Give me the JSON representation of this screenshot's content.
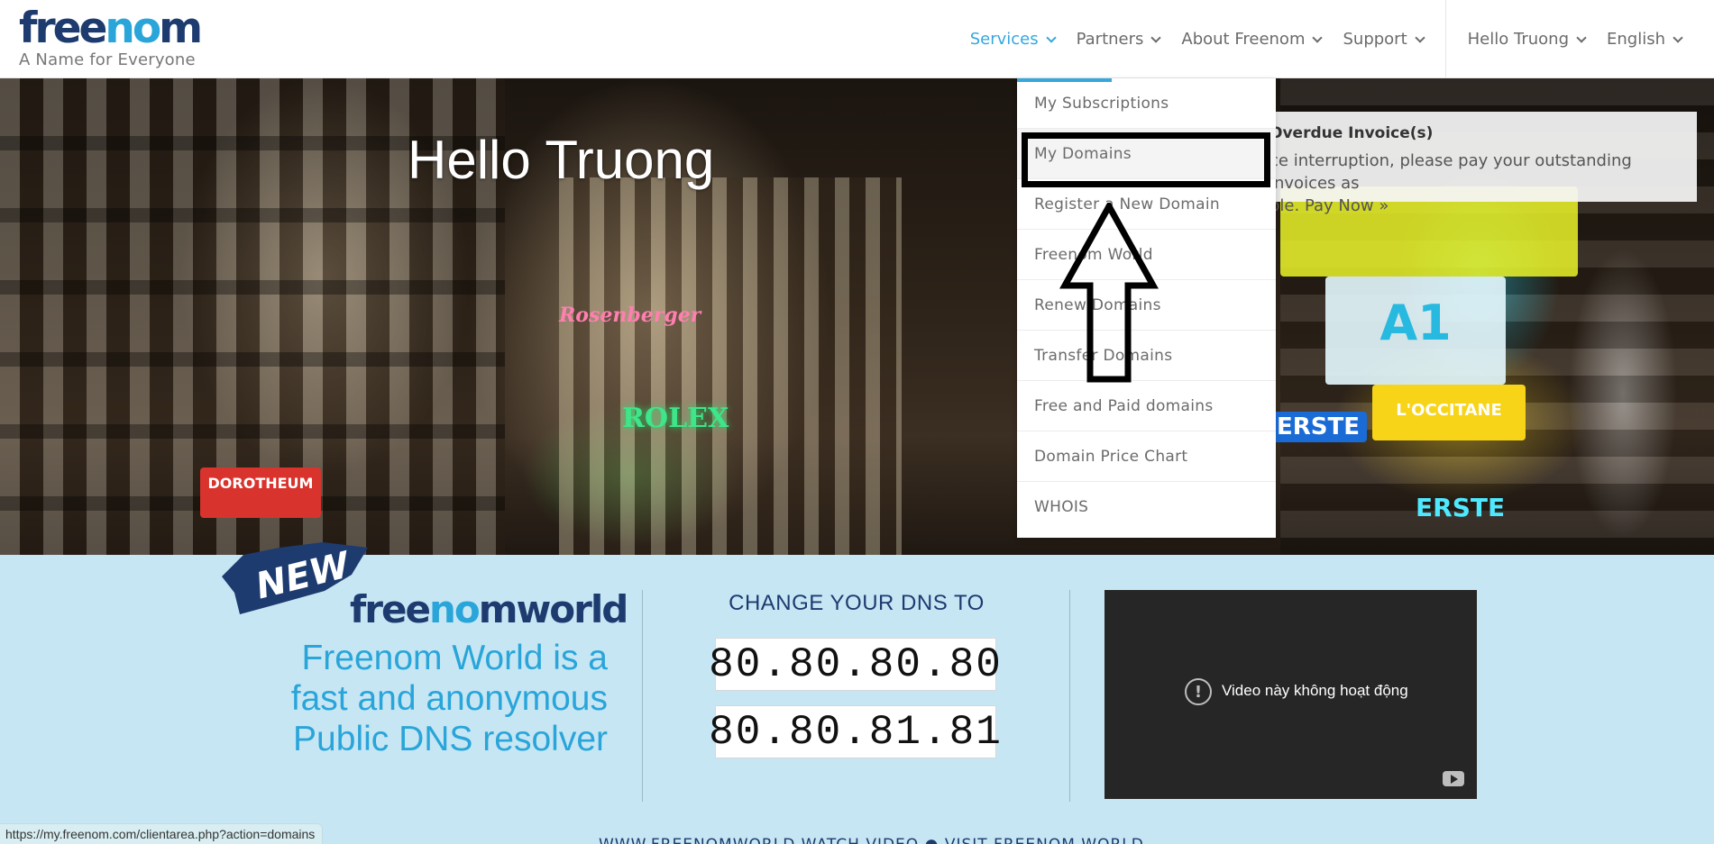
{
  "header": {
    "logo_text_pre": "free",
    "logo_text_o": "no",
    "logo_text_post": "m",
    "tagline": "A Name for Everyone",
    "nav": [
      {
        "label": "Services",
        "active": true
      },
      {
        "label": "Partners"
      },
      {
        "label": "About Freenom"
      },
      {
        "label": "Support"
      }
    ],
    "user_menu": "Hello Truong",
    "language": "English"
  },
  "hero": {
    "title": "Hello Truong",
    "signs": {
      "rolex": "ROLEX",
      "dorotheum": "DOROTHEUM",
      "erste1": "ERSTE",
      "erste2": "ERSTE",
      "loccitane": "L'OCCITANE",
      "a1": "A1",
      "rosenberger": "Rosenberger"
    }
  },
  "overdue": {
    "title": "Overdue Invoice(s)",
    "line1": "ce interruption, please pay your outstanding invoices as",
    "line2_pre": "ble. ",
    "pay_now": "Pay Now »"
  },
  "services_menu": {
    "items": [
      "My Subscriptions",
      "My Domains",
      "Register a New Domain",
      "Freenom World",
      "Renew Domains",
      "Transfer Domains",
      "Free and Paid domains",
      "Domain Price Chart",
      "WHOIS"
    ],
    "highlighted_index": 1
  },
  "freenom_world": {
    "badge": "NEW",
    "logo_pre": "free",
    "logo_o": "no",
    "logo_post": "mworld",
    "tagline": "Freenom World is a fast and anonymous Public DNS resolver"
  },
  "dns": {
    "heading": "CHANGE YOUR DNS TO",
    "primary": "80.80.80.80",
    "secondary": "80.80.81.81"
  },
  "video": {
    "message": "Video này không hoạt động"
  },
  "bottom_links": "WWW.FREENOMWORLD  WATCH VIDEO  ●  VISIT FREENOM WORLD",
  "status_bar": {
    "url": "https://my.freenom.com/clientarea.php?action=domains"
  },
  "colors": {
    "accent": "#35a7dd",
    "navy": "#1d3b6f",
    "band": "#c7e6f4"
  }
}
